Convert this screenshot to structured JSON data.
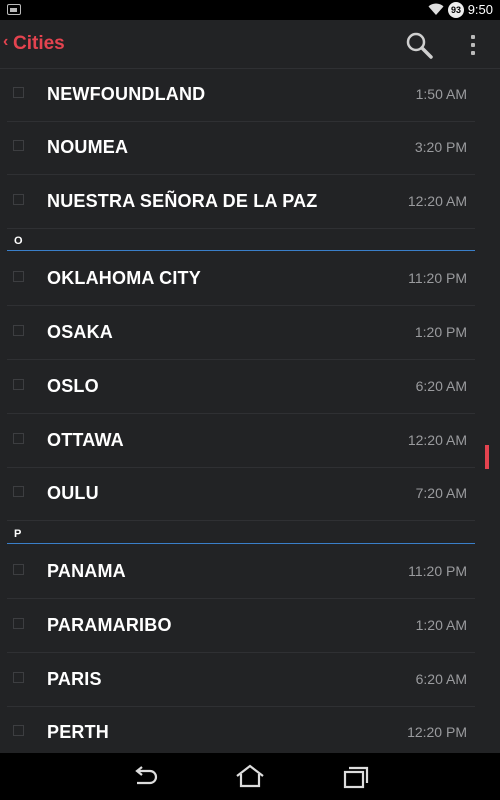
{
  "status_bar": {
    "time": "9:50",
    "battery": "93",
    "icons": [
      "image-icon",
      "wifi-icon",
      "battery-icon"
    ]
  },
  "action_bar": {
    "title": "Cities",
    "icons": [
      "back-chevron-icon",
      "search-icon",
      "overflow-menu-icon"
    ],
    "accent": "#e4434f"
  },
  "sections": {
    "n_tail": [
      {
        "city": "NEWFOUNDLAND",
        "time": "1:50 AM"
      },
      {
        "city": "NOUMEA",
        "time": "3:20 PM"
      },
      {
        "city": "NUESTRA SEÑORA DE LA PAZ",
        "time": "12:20 AM"
      }
    ],
    "o": {
      "header": "O",
      "items": [
        {
          "city": "OKLAHOMA CITY",
          "time": "11:20 PM"
        },
        {
          "city": "OSAKA",
          "time": "1:20 PM"
        },
        {
          "city": "OSLO",
          "time": "6:20 AM"
        },
        {
          "city": "OTTAWA",
          "time": "12:20 AM"
        },
        {
          "city": "OULU",
          "time": "7:20 AM"
        }
      ]
    },
    "p": {
      "header": "P",
      "items": [
        {
          "city": "PANAMA",
          "time": "11:20 PM"
        },
        {
          "city": "PARAMARIBO",
          "time": "1:20 AM"
        },
        {
          "city": "PARIS",
          "time": "6:20 AM"
        },
        {
          "city": "PERTH",
          "time": "12:20 PM"
        }
      ]
    }
  },
  "nav_bar": {
    "icons": [
      "back-icon",
      "home-icon",
      "recent-apps-icon"
    ]
  }
}
